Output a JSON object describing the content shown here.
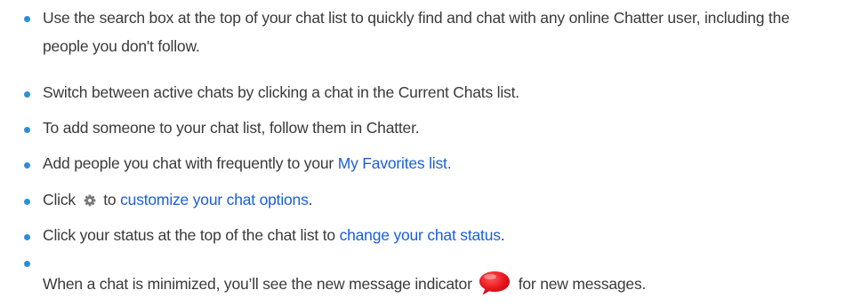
{
  "tips": [
    {
      "parts": [
        {
          "text": "Use the search box at the top of your chat list to quickly find and chat with any online Chatter user, including the people you don't follow."
        }
      ]
    },
    {
      "parts": [
        {
          "text": "Switch between active chats by clicking a chat in the Current Chats list."
        }
      ]
    },
    {
      "parts": [
        {
          "text": "To add someone to your chat list, follow them in Chatter."
        }
      ]
    },
    {
      "parts": [
        {
          "text": "Add people you chat with frequently to your "
        },
        {
          "link": "My Favorites list."
        }
      ]
    },
    {
      "parts": [
        {
          "text": "Click "
        },
        {
          "icon": "gear-icon"
        },
        {
          "text": " to "
        },
        {
          "link": "customize your chat options"
        },
        {
          "text": "."
        }
      ]
    },
    {
      "parts": [
        {
          "text": "Click your status at the top of the chat list to "
        },
        {
          "link": "change your chat status"
        },
        {
          "text": "."
        }
      ]
    },
    {
      "parts": [
        {
          "text": "When a chat is minimized, you’ll see the new message indicator"
        },
        {
          "icon": "new-message-indicator-icon"
        },
        {
          "text": "for new messages."
        }
      ]
    }
  ],
  "colors": {
    "bullet": "#2b8fd6",
    "link": "#1a5fd6",
    "text": "#3a3a3a",
    "indicator": "#e8141b"
  }
}
